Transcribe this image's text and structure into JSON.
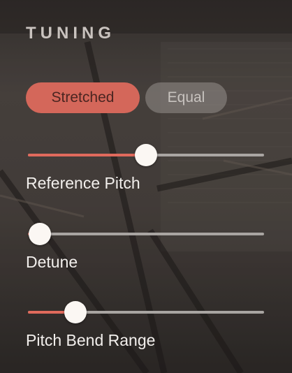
{
  "panel": {
    "title": "TUNING"
  },
  "tuning_mode": {
    "options": [
      "Stretched",
      "Equal"
    ],
    "selected": "Stretched"
  },
  "sliders": [
    {
      "label": "Reference Pitch",
      "value_fraction": 0.5
    },
    {
      "label": "Detune",
      "value_fraction": 0.05
    },
    {
      "label": "Pitch Bend Range",
      "value_fraction": 0.2
    }
  ],
  "colors": {
    "accent": "#d4675a",
    "track": "#a9a5a2",
    "thumb": "#fbf7f3",
    "text": "#f2efec"
  }
}
